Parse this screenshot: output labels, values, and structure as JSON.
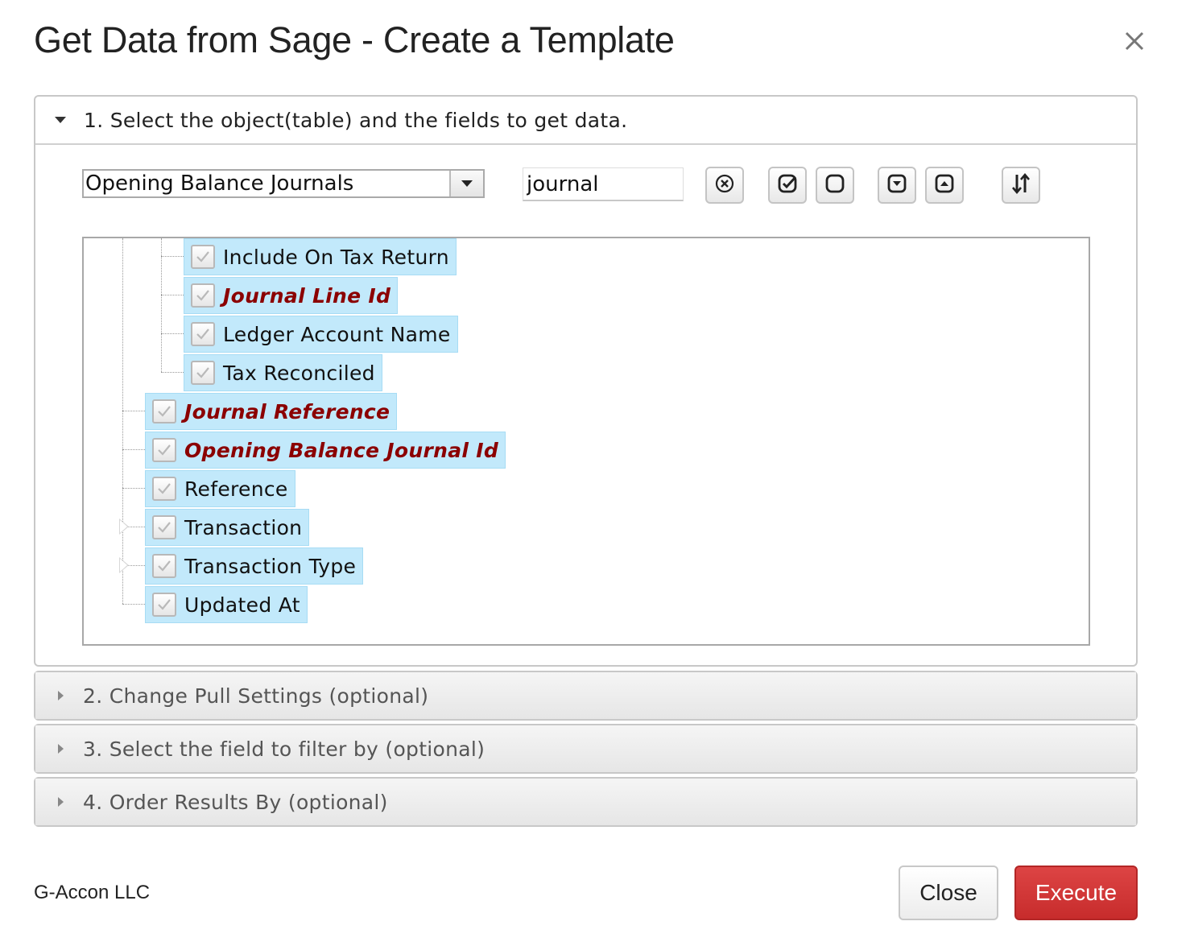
{
  "dialog": {
    "title": "Get Data from Sage - Create a Template"
  },
  "sections": [
    {
      "label": "1. Select the object(table) and the fields to get data.",
      "expanded": true
    },
    {
      "label": "2. Change Pull Settings (optional)",
      "expanded": false
    },
    {
      "label": "3. Select the field to filter by (optional)",
      "expanded": false
    },
    {
      "label": "4. Order Results By (optional)",
      "expanded": false
    }
  ],
  "object_select": {
    "value": "Opening Balance Journals"
  },
  "search": {
    "value": "journal"
  },
  "toolbar": [
    {
      "icon": "clear-circle-x-icon"
    },
    {
      "icon": "check-all-icon"
    },
    {
      "icon": "uncheck-all-icon"
    },
    {
      "icon": "expand-all-icon"
    },
    {
      "icon": "collapse-all-icon"
    },
    {
      "icon": "sort-icon"
    }
  ],
  "tree": {
    "children": [
      {
        "label": "Include On Tax Return",
        "checked": true,
        "key": false
      },
      {
        "label": "Journal Line Id",
        "checked": true,
        "key": true
      },
      {
        "label": "Ledger Account Name",
        "checked": true,
        "key": false
      },
      {
        "label": "Tax Reconciled",
        "checked": true,
        "key": false
      }
    ],
    "fields": [
      {
        "label": "Journal Reference",
        "checked": true,
        "key": true,
        "expandable": false
      },
      {
        "label": "Opening Balance Journal Id",
        "checked": true,
        "key": true,
        "expandable": false
      },
      {
        "label": "Reference",
        "checked": true,
        "key": false,
        "expandable": false
      },
      {
        "label": "Transaction",
        "checked": true,
        "key": false,
        "expandable": true
      },
      {
        "label": "Transaction Type",
        "checked": true,
        "key": false,
        "expandable": true
      },
      {
        "label": "Updated At",
        "checked": true,
        "key": false,
        "expandable": false
      }
    ]
  },
  "footer": {
    "brand": "G-Accon LLC",
    "close_label": "Close",
    "execute_label": "Execute"
  },
  "colors": {
    "key_field": "#8b0000",
    "node_highlight": "#c2e9fb",
    "execute_button": "#d03535"
  }
}
